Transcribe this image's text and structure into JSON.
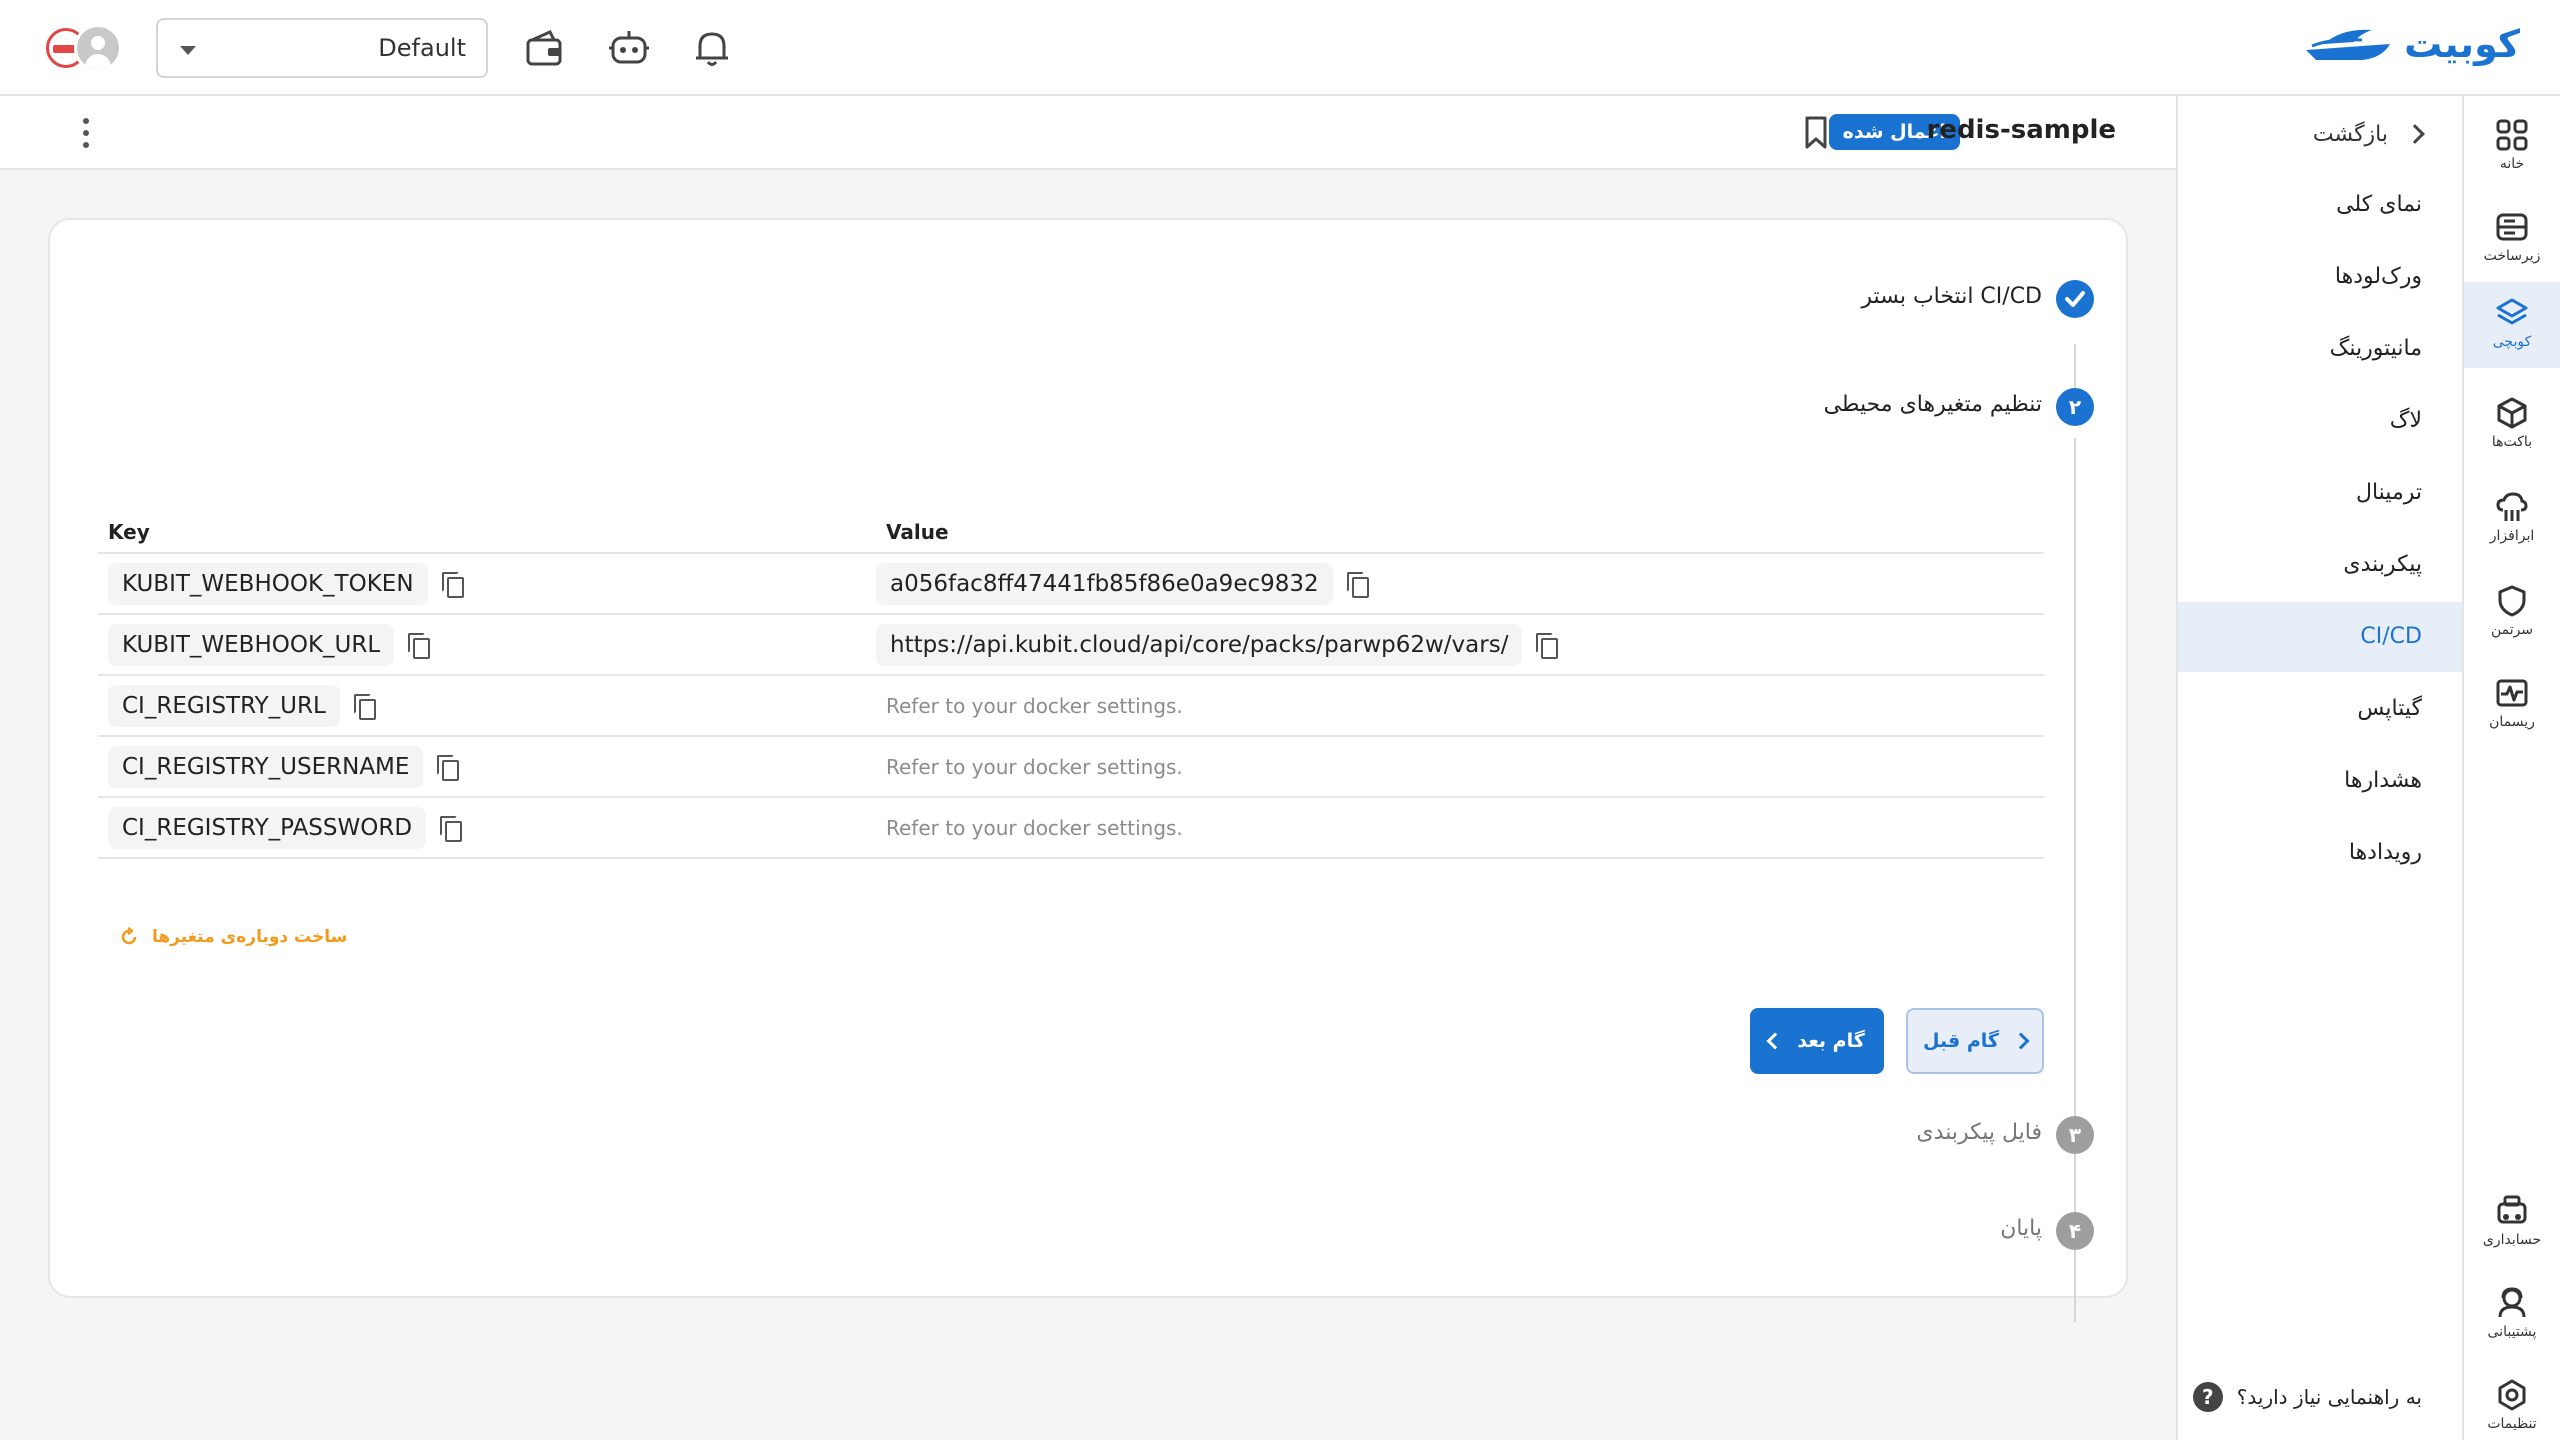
{
  "topbar": {
    "logo_text": "کوبیت",
    "workspace": "Default",
    "icons": [
      "wallet-icon",
      "robot-icon",
      "bell-icon"
    ]
  },
  "subheader": {
    "app_name": "redis-sample",
    "status_badge": "اعمال شده"
  },
  "sidemenu": {
    "back_label": "بازگشت",
    "items": [
      "نمای کلی",
      "ورک‌لودها",
      "مانیتورینگ",
      "لاگ",
      "ترمینال",
      "پیکربندی",
      "CI/CD",
      "گیتاپس",
      "هشدارها",
      "رویدادها"
    ],
    "active_item": "CI/CD",
    "help_label": "به راهنمایی نیاز دارید؟"
  },
  "rail": {
    "items": [
      {
        "label": "خانه",
        "icon": "home-grid-icon"
      },
      {
        "label": "زیرساخت",
        "icon": "server-icon"
      },
      {
        "label": "کوبچی",
        "icon": "layers-icon"
      },
      {
        "label": "باکت‌ها",
        "icon": "cube-icon"
      },
      {
        "label": "ابرافزار",
        "icon": "cloud-app-icon"
      },
      {
        "label": "سرتمن",
        "icon": "shield-icon"
      },
      {
        "label": "ریسمان",
        "icon": "pulse-icon"
      },
      {
        "label": "حسابداری",
        "icon": "billing-icon"
      },
      {
        "label": "پشتیبانی",
        "icon": "support-icon"
      },
      {
        "label": "تنظیمات",
        "icon": "settings-icon"
      }
    ],
    "active_index": 2
  },
  "stepper": {
    "steps": [
      {
        "number": "",
        "label": "انتخاب بستر CI/CD",
        "state": "done"
      },
      {
        "number": "۲",
        "label": "تنظیم متغیرهای محیطی",
        "state": "active"
      },
      {
        "number": "۳",
        "label": "فایل پیکربندی",
        "state": "pending"
      },
      {
        "number": "۴",
        "label": "پایان",
        "state": "pending"
      }
    ]
  },
  "vars_table": {
    "headers": {
      "key": "Key",
      "value": "Value"
    },
    "rows": [
      {
        "key": "KUBIT_WEBHOOK_TOKEN",
        "value": "a056fac8ff47441fb85f86e0a9ec9832",
        "value_is_hint": false
      },
      {
        "key": "KUBIT_WEBHOOK_URL",
        "value": "https://api.kubit.cloud/api/core/packs/parwp62w/vars/",
        "value_is_hint": false
      },
      {
        "key": "CI_REGISTRY_URL",
        "value": "Refer to your docker settings.",
        "value_is_hint": true
      },
      {
        "key": "CI_REGISTRY_USERNAME",
        "value": "Refer to your docker settings.",
        "value_is_hint": true
      },
      {
        "key": "CI_REGISTRY_PASSWORD",
        "value": "Refer to your docker settings.",
        "value_is_hint": true
      }
    ]
  },
  "regen_label": "ساخت دوباره‌ی متغیرها",
  "buttons": {
    "next": "گام بعد",
    "prev": "گام قبل"
  },
  "colors": {
    "primary": "#1a73d0",
    "accent_orange": "#f29a1c",
    "active_bg": "#e8eef8"
  }
}
